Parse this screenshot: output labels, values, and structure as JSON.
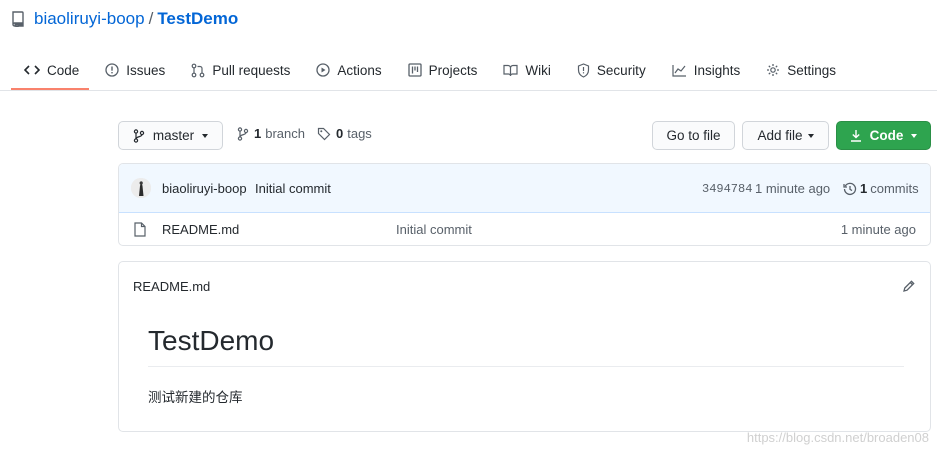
{
  "header": {
    "owner": "biaoliruyi-boop",
    "separator": "/",
    "repo": "TestDemo",
    "repo_icon": "repo-icon"
  },
  "tabs": [
    {
      "label": "Code",
      "icon": "code-icon",
      "active": true
    },
    {
      "label": "Issues",
      "icon": "issue-icon"
    },
    {
      "label": "Pull requests",
      "icon": "pull-request-icon"
    },
    {
      "label": "Actions",
      "icon": "play-icon"
    },
    {
      "label": "Projects",
      "icon": "project-icon"
    },
    {
      "label": "Wiki",
      "icon": "book-icon"
    },
    {
      "label": "Security",
      "icon": "shield-icon"
    },
    {
      "label": "Insights",
      "icon": "graph-icon"
    },
    {
      "label": "Settings",
      "icon": "gear-icon"
    }
  ],
  "toolbar": {
    "branch_label": "master",
    "branch_count": "1",
    "branch_word": "branch",
    "tag_count": "0",
    "tag_word": "tags",
    "go_to_file": "Go to file",
    "add_file": "Add file",
    "code": "Code"
  },
  "latest_commit": {
    "author": "biaoliruyi-boop",
    "message": "Initial commit",
    "sha": "3494784",
    "age": "1 minute ago",
    "count": "1",
    "count_word": "commits"
  },
  "files": [
    {
      "name": "README.md",
      "commit": "Initial commit",
      "age": "1 minute ago",
      "icon": "file-icon"
    }
  ],
  "readme": {
    "title": "README.md",
    "heading": "TestDemo",
    "body": "测试新建的仓库"
  },
  "watermark": "https://blog.csdn.net/broaden08",
  "colors": {
    "link": "#0366d6",
    "active_tab_underline": "#f9826c",
    "primary_button": "#2ea44f",
    "commit_row_bg": "#f1f8ff"
  }
}
